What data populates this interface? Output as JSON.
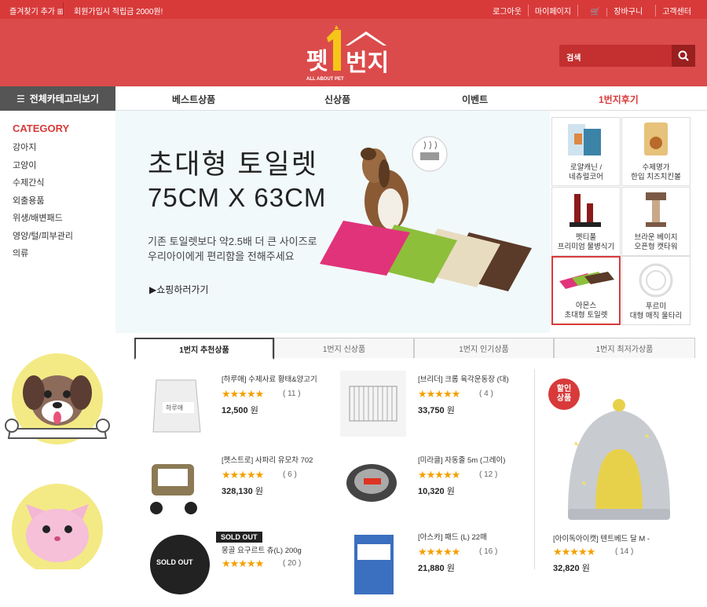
{
  "topbar": {
    "bookmark": "즐겨찾기 추가",
    "promo": "회원가입시 적립금 2000원!",
    "links": [
      "로그아웃",
      "마이페이지",
      "장바구니",
      "고객센터"
    ]
  },
  "header": {
    "logo_text": "펫1번지",
    "logo_sub": "ALL ABOUT PET",
    "search_label": "검색",
    "search_value": ""
  },
  "nav": {
    "all_categories": "전체카테고리보기",
    "items": [
      "베스트상품",
      "신상품",
      "이벤트",
      "1번지후기"
    ]
  },
  "sidebar": {
    "title": "CATEGORY",
    "items": [
      "강아지",
      "고양이",
      "수제간식",
      "외출용품",
      "위생/배변패드",
      "영양/털/피부관리",
      "의류"
    ]
  },
  "banner": {
    "title1": "초대형 토일렛",
    "title2": "75CM X 63CM",
    "desc1": "기존 토일렛보다 약2.5배 더 큰 사이즈로",
    "desc2": "우리아이에게 편리함을 전해주세요",
    "shop": "쇼핑하러가기"
  },
  "thumbs": [
    {
      "line1": "로얄캐닌 /",
      "line2": "네츄럴코어"
    },
    {
      "line1": "수제명가",
      "line2": "한입 치즈치킨볼"
    },
    {
      "line1": "펫티풀",
      "line2": "프리미엄 물병식기"
    },
    {
      "line1": "브라운 베이지",
      "line2": "오픈형 캣타워"
    },
    {
      "line1": "아몬스",
      "line2": "초대형 토일렛"
    },
    {
      "line1": "푸르미",
      "line2": "대형 매직 울타리"
    }
  ],
  "tabs": [
    "1번지 추천상품",
    "1번지 신상품",
    "1번지 인기상품",
    "1번지 최저가상품"
  ],
  "products": [
    {
      "name": "[하루애] 수제사료 황태&양고기",
      "stars": "★★★★★",
      "count": "( 11 )",
      "price": "12,500",
      "unit": " 원"
    },
    {
      "name": "[브리더] 크롬 육각운동장 (대)",
      "stars": "★★★★★",
      "count": "( 4 )",
      "price": "33,750",
      "unit": " 원"
    },
    {
      "name": "[펫스트로] 사파리 유모차 702",
      "stars": "★★★★★",
      "count": "( 6 )",
      "price": "328,130",
      "unit": " 원"
    },
    {
      "name": "[미라클] 자동줄 5m (그레이)",
      "stars": "★★★★★",
      "count": "( 12 )",
      "price": "10,320",
      "unit": " 원"
    },
    {
      "name": "몽골 요구르트 츄(L) 200g",
      "stars": "★★★★★",
      "count": "( 20 )",
      "price": "",
      "unit": ""
    },
    {
      "name": "[아스카] 패드 (L) 22매",
      "stars": "★★★★★",
      "count": "( 16 )",
      "price": "21,880",
      "unit": " 원"
    }
  ],
  "soldout": "SOLD OUT",
  "featured": {
    "badge1": "할인",
    "badge2": "상품",
    "name": "[아이독아이캣] 텐트베드 달 M -",
    "stars": "★★★★★",
    "count": "( 14 )",
    "price": "32,820",
    "unit": " 원"
  },
  "colors": {
    "brand": "#d83a3a",
    "header_bg": "#db4b4b",
    "star": "#f3a000"
  },
  "icons": [
    "search-icon",
    "menu-icon",
    "cart-icon",
    "bookmark-icon",
    "play-icon"
  ]
}
